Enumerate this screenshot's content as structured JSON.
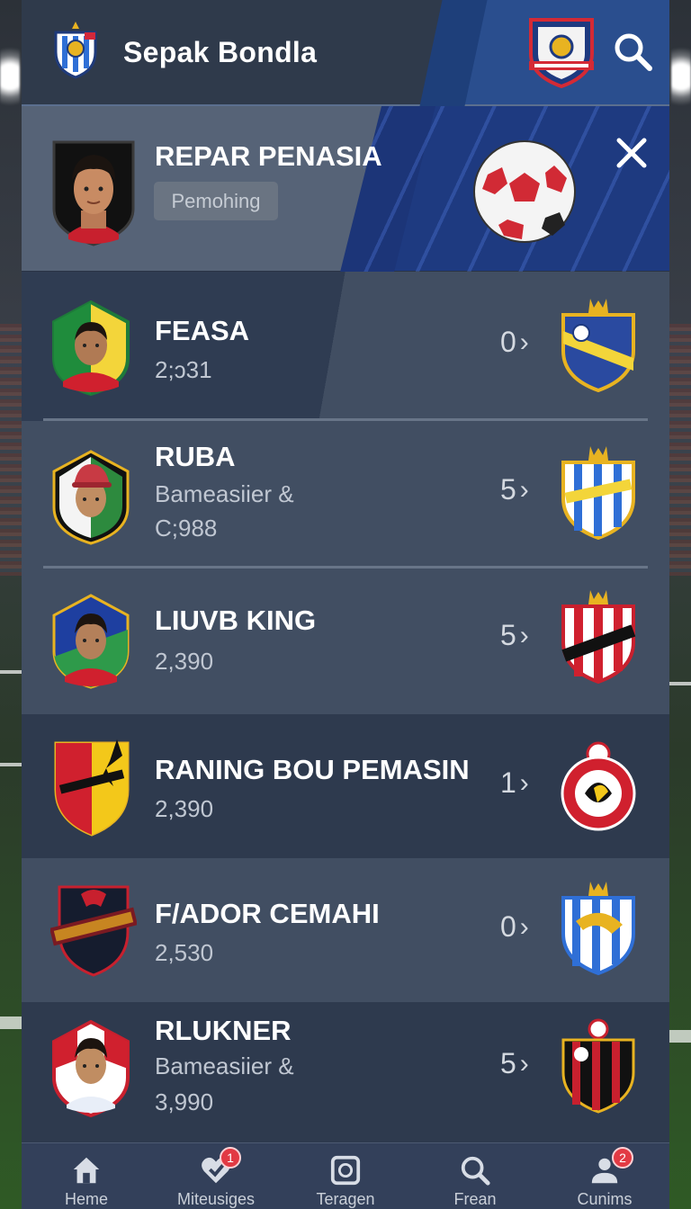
{
  "app": {
    "title": "Sepak Bondla"
  },
  "featured": {
    "title": "REPAR PENASIA",
    "chip": "Pemohing"
  },
  "players": [
    {
      "name": "FEASA",
      "subtitle": "",
      "value": "2;ɔ31",
      "count": "0"
    },
    {
      "name": "RUBA",
      "subtitle": "Bameasiier &",
      "value": "C;988",
      "count": "5"
    },
    {
      "name": "LIUVB KING",
      "subtitle": "",
      "value": "2,390",
      "count": "5"
    },
    {
      "name": "RANING BOU PEMASIN",
      "subtitle": "",
      "value": "2,390",
      "count": "1"
    },
    {
      "name": "F/ADOR CEMAHI",
      "subtitle": "",
      "value": "2,530",
      "count": "0"
    },
    {
      "name": "RLUKNER",
      "subtitle": "Bameasiier &",
      "value": "3,990",
      "count": "5"
    }
  ],
  "nav": [
    {
      "label": "Heme",
      "icon": "home-icon",
      "badge": ""
    },
    {
      "label": "Miteusiges",
      "icon": "heart-icon",
      "badge": "1"
    },
    {
      "label": "Teragen",
      "icon": "square-icon",
      "badge": ""
    },
    {
      "label": "Frean",
      "icon": "search-icon",
      "badge": ""
    },
    {
      "label": "Cunims",
      "icon": "user-icon",
      "badge": "2"
    }
  ],
  "colors": {
    "accent_blue": "#1e3a80",
    "panel": "#414e62",
    "panel_dark": "#2e3a4e",
    "badge_red": "#e23a44"
  }
}
